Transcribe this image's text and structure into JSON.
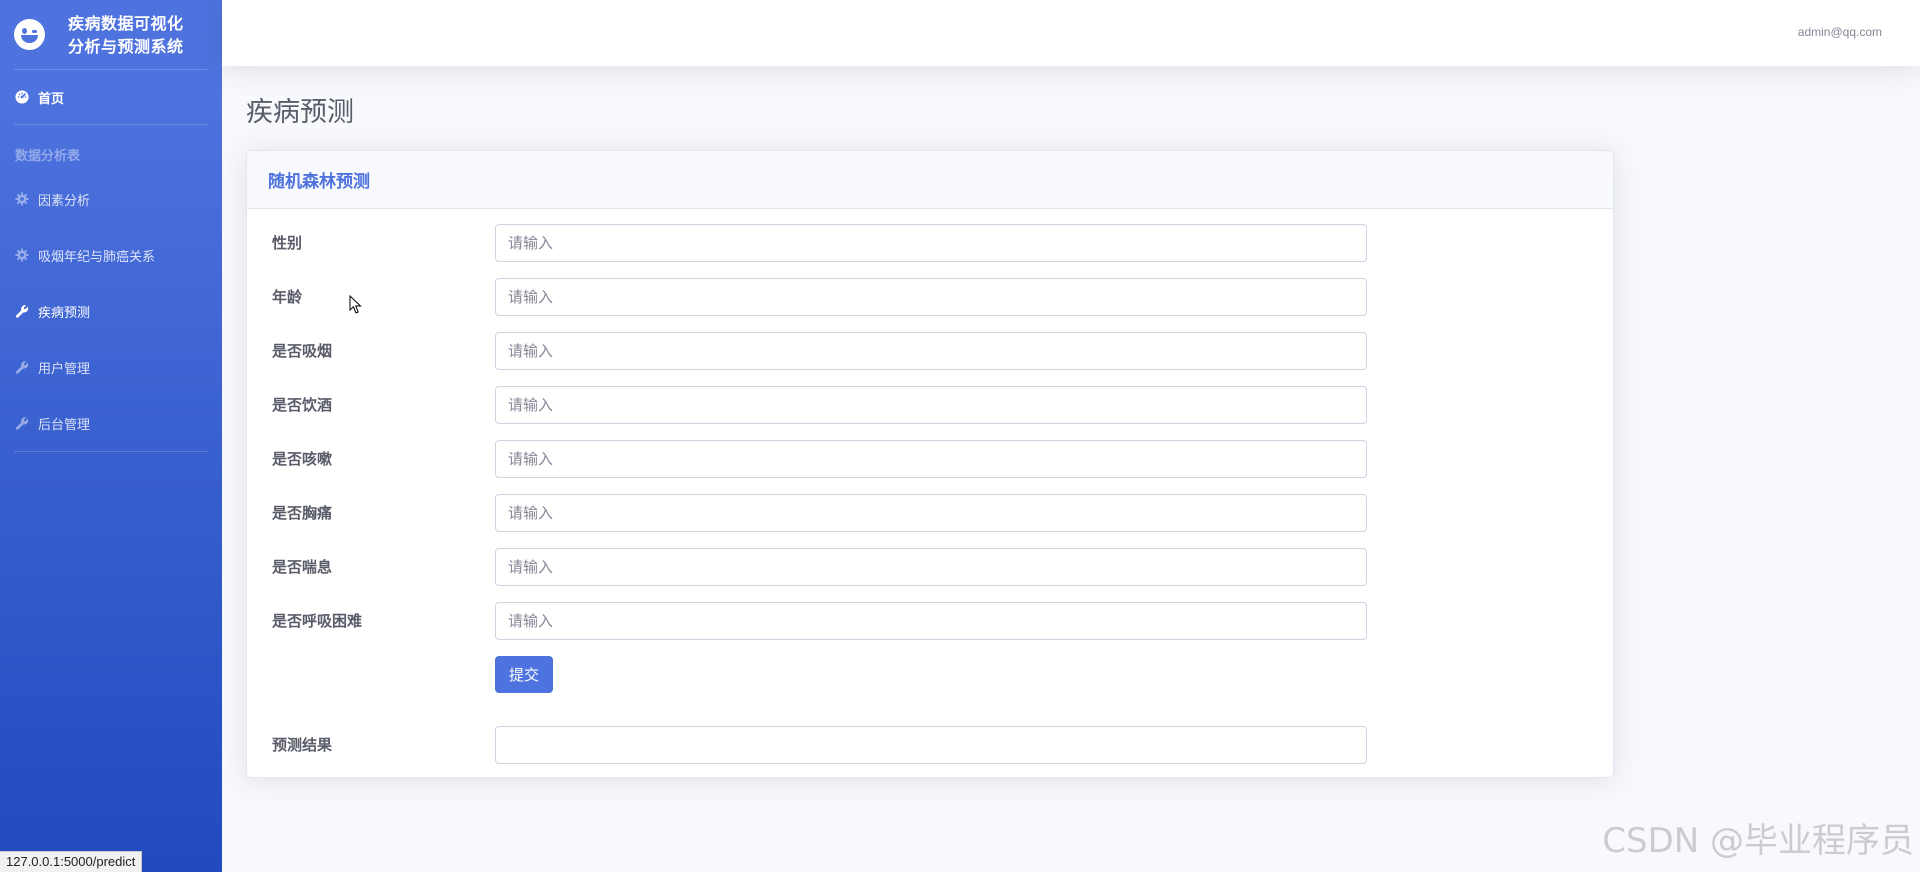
{
  "sidebar": {
    "brand_line1": "疾病数据可视化",
    "brand_line2": "分析与预测系统",
    "home": "首页",
    "section_heading": "数据分析表",
    "items": [
      {
        "label": "因素分析",
        "icon": "cog-icon"
      },
      {
        "label": "吸烟年纪与肺癌关系",
        "icon": "cog-icon"
      },
      {
        "label": "疾病预测",
        "icon": "wrench-icon"
      },
      {
        "label": "用户管理",
        "icon": "wrench-icon"
      },
      {
        "label": "后台管理",
        "icon": "wrench-icon"
      }
    ],
    "active": "疾病预测",
    "accent_top": "#4e73df",
    "accent_bottom": "#224abe"
  },
  "topbar": {
    "user_email": "admin@qq.com"
  },
  "page": {
    "title": "疾病预测"
  },
  "card": {
    "title": "随机森林预测",
    "fields": [
      {
        "label": "性别",
        "placeholder": "请输入",
        "value": ""
      },
      {
        "label": "年龄",
        "placeholder": "请输入",
        "value": ""
      },
      {
        "label": "是否吸烟",
        "placeholder": "请输入",
        "value": ""
      },
      {
        "label": "是否饮酒",
        "placeholder": "请输入",
        "value": ""
      },
      {
        "label": "是否咳嗽",
        "placeholder": "请输入",
        "value": ""
      },
      {
        "label": "是否胸痛",
        "placeholder": "请输入",
        "value": ""
      },
      {
        "label": "是否喘息",
        "placeholder": "请输入",
        "value": ""
      },
      {
        "label": "是否呼吸困难",
        "placeholder": "请输入",
        "value": ""
      }
    ],
    "submit_label": "提交",
    "result_label": "预测结果",
    "result_value": ""
  },
  "status_bar_url": "127.0.0.1:5000/predict",
  "watermark": "CSDN @毕业程序员"
}
